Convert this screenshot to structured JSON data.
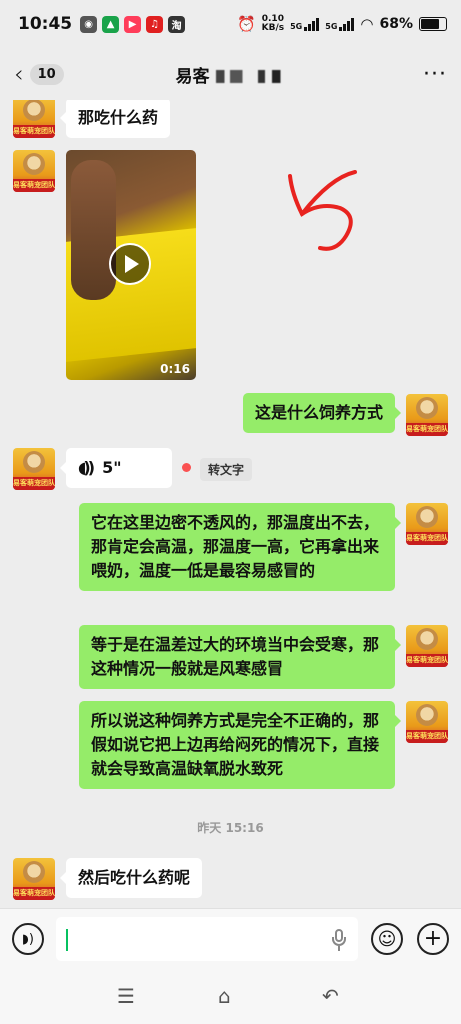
{
  "status_bar": {
    "time": "10:45",
    "app_icons": [
      {
        "name": "wechat-icon",
        "glyph": "◉",
        "color": "#555555"
      },
      {
        "name": "camera-icon",
        "glyph": "▲",
        "color": "#1aa34a"
      },
      {
        "name": "video-app-icon",
        "glyph": "▶",
        "color": "#ff3d5a"
      },
      {
        "name": "netease-icon",
        "glyph": "♫",
        "color": "#e02020"
      },
      {
        "name": "taobao-icon",
        "glyph": "淘",
        "color": "#333333"
      }
    ],
    "speed_value": "0.10",
    "speed_unit": "KB/s",
    "signal1_label": "5G",
    "signal2_label": "5G",
    "battery": "68%"
  },
  "header": {
    "unread_count": "10",
    "title": "易客"
  },
  "avatar_label": "易客萌宠团队",
  "messages": [
    {
      "side": "left",
      "type": "text",
      "text": "那吃什么药"
    },
    {
      "side": "left",
      "type": "video",
      "duration": "0:16"
    },
    {
      "side": "right",
      "type": "text",
      "text": "这是什么饲养方式"
    },
    {
      "side": "left",
      "type": "voice",
      "duration": "5\"",
      "transcribe_label": "转文字"
    },
    {
      "side": "right",
      "type": "text",
      "text": "它在这里边密不透风的，那温度出不去，那肯定会高温，那温度一高，它再拿出来喂奶，温度一低是最容易感冒的"
    },
    {
      "side": "right",
      "type": "text",
      "text": "等于是在温差过大的环境当中会受寒，那这种情况一般就是风寒感冒"
    },
    {
      "side": "right",
      "type": "text",
      "text": "所以说这种饲养方式是完全不正确的，那假如说它把上边再给闷死的情况下，直接就会导致高温缺氧脱水致死"
    },
    {
      "side": "center",
      "type": "timestamp",
      "text": "昨天 15:16"
    },
    {
      "side": "left",
      "type": "text",
      "text": "然后吃什么药呢"
    }
  ],
  "input_bar": {
    "value": ""
  },
  "colors": {
    "chat_bg": "#ededed",
    "green_bubble": "#95ec69",
    "annotation_red": "#e8231f",
    "unread_dot": "#fa5151"
  }
}
